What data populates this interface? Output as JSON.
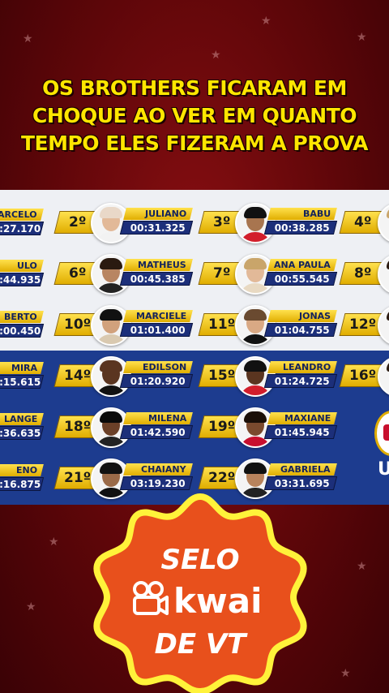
{
  "headline": [
    "OS BROTHERS FICARAM EM",
    "CHOQUE AO VER EM QUANTO",
    "TEMPO ELES FIZERAM A PROVA"
  ],
  "ranking": {
    "partial_left": [
      {
        "name": "ARCELO",
        "time": "0:27.170"
      },
      {
        "name": "ULO",
        "time": "0:44.935"
      },
      {
        "name": "BERTO",
        "time": "1:00.450"
      },
      {
        "name": "MIRA",
        "time": "1:15.615"
      },
      {
        "name": "LANGE",
        "time": "1:36.635"
      },
      {
        "name": "ENO",
        "time": "2:16.875"
      }
    ],
    "col2": [
      {
        "rank": "2º",
        "name": "JULIANO",
        "time": "00:31.325"
      },
      {
        "rank": "6º",
        "name": "MATHEUS",
        "time": "00:45.385"
      },
      {
        "rank": "10º",
        "name": "MARCIELE",
        "time": "01:01.400"
      },
      {
        "rank": "14º",
        "name": "EDILSON",
        "time": "01:20.920"
      },
      {
        "rank": "18º",
        "name": "MILENA",
        "time": "01:42.590"
      },
      {
        "rank": "21º",
        "name": "CHAIANY",
        "time": "03:19.230"
      }
    ],
    "col3": [
      {
        "rank": "3º",
        "name": "BABU",
        "time": "00:38.285"
      },
      {
        "rank": "7º",
        "name": "ANA PAULA",
        "time": "00:55.545"
      },
      {
        "rank": "11º",
        "name": "JONAS",
        "time": "01:04.755"
      },
      {
        "rank": "15º",
        "name": "LEANDRO",
        "time": "01:24.725"
      },
      {
        "rank": "19º",
        "name": "MAXIANE",
        "time": "01:45.945"
      },
      {
        "rank": "22º",
        "name": "GABRIELA",
        "time": "03:31.695"
      }
    ],
    "partial_right": [
      {
        "rank": "4º"
      },
      {
        "rank": "8º"
      },
      {
        "rank": "12º"
      },
      {
        "rank": "16º"
      }
    ],
    "edge_text": "U"
  },
  "seal": {
    "line1": "SELO",
    "brand": "kwai",
    "line3": "DE VT",
    "colors": {
      "fill": "#e8501c",
      "border": "#fff23a"
    }
  }
}
